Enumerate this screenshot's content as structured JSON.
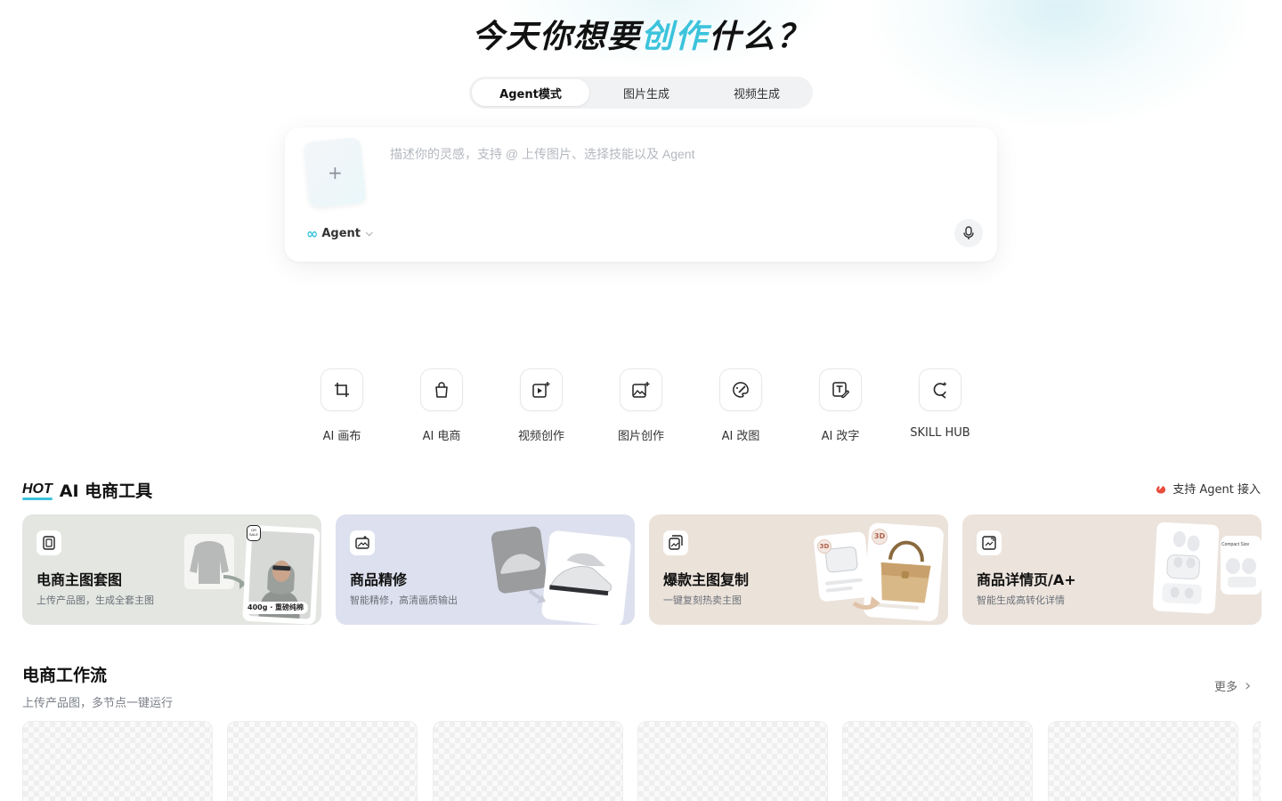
{
  "hero": {
    "title_before": "今天你想要",
    "title_accent": "创作",
    "title_after": "什么？",
    "accent_color": "#3cc3dc"
  },
  "mode_tabs": [
    {
      "label": "Agent模式",
      "active": true
    },
    {
      "label": "图片生成",
      "active": false
    },
    {
      "label": "视频生成",
      "active": false
    }
  ],
  "prompt": {
    "upload_symbol": "+",
    "placeholder": "描述你的灵感，支持 @ 上传图片、选择技能以及 Agent",
    "value": "",
    "agent_icon": "∞",
    "agent_label": "Agent",
    "agent_chevron": "⌵",
    "mic_icon": "microphone-icon"
  },
  "tools": [
    {
      "label": "AI 画布",
      "icon": "crop-frame-icon"
    },
    {
      "label": "AI 电商",
      "icon": "shopping-bag-icon"
    },
    {
      "label": "视频创作",
      "icon": "video-sparkle-icon"
    },
    {
      "label": "图片创作",
      "icon": "image-sparkle-icon"
    },
    {
      "label": "AI 改图",
      "icon": "palette-edit-icon"
    },
    {
      "label": "AI 改字",
      "icon": "text-edit-icon"
    },
    {
      "label": "SKILL HUB",
      "icon": "skill-hub-icon"
    }
  ],
  "ecommerce": {
    "hot_badge": "HOT",
    "title": "AI 电商工具",
    "agent_support": "支持 Agent 接入",
    "cards": [
      {
        "title": "电商主图套图",
        "desc": "上传产品图，生成全套主图",
        "bg": "#e3e6e1",
        "icon": "image-set-icon",
        "tag1": "OR SALE",
        "tag2": "400g · 重磅纯棉"
      },
      {
        "title": "商品精修",
        "desc": "智能精修，高清画质输出",
        "bg": "#dde0ee",
        "icon": "retouch-icon"
      },
      {
        "title": "爆款主图复制",
        "desc": "一键复刻热卖主图",
        "bg": "#ebe2da",
        "icon": "copy-image-icon",
        "tag1": "3D",
        "tag2": "3D"
      },
      {
        "title": "商品详情页/A+",
        "desc": "智能生成高转化详情",
        "bg": "#ebe3dc",
        "icon": "detail-page-icon",
        "tag1": "Compact Size"
      }
    ]
  },
  "workflow": {
    "title": "电商工作流",
    "subtitle": "上传产品图，多节点一键运行",
    "more_label": "更多",
    "more_icon": "›"
  }
}
